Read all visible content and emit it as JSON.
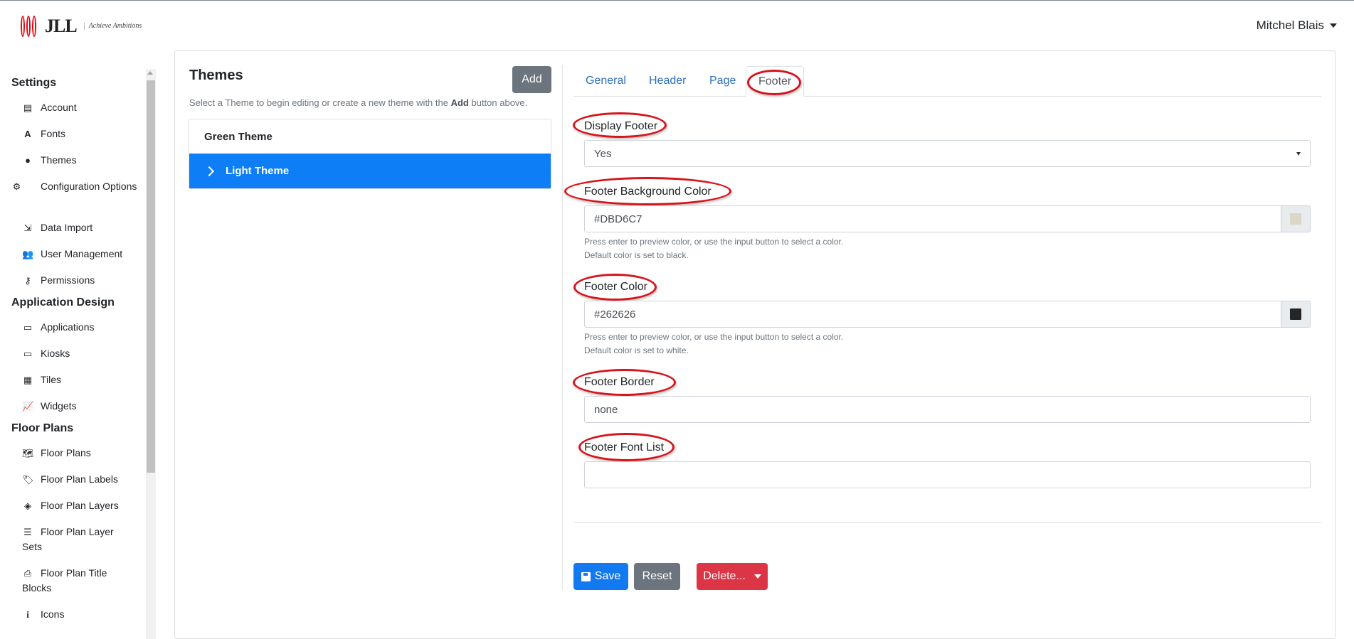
{
  "header": {
    "logo_text": "JLL",
    "logo_tagline": "Achieve Ambitions",
    "user_name": "Mitchel Blais"
  },
  "sidebar": {
    "sections": [
      {
        "title": "Settings",
        "items": [
          {
            "label": "Account",
            "icon": "table-icon"
          },
          {
            "label": "Fonts",
            "icon": "font-icon"
          },
          {
            "label": "Themes",
            "icon": "palette-icon"
          },
          {
            "label": "Configuration Options",
            "icon": "gear-icon"
          },
          {
            "label": "Data Import",
            "icon": "file-import-icon"
          },
          {
            "label": "User Management",
            "icon": "users-icon"
          },
          {
            "label": "Permissions",
            "icon": "key-icon"
          }
        ]
      },
      {
        "title": "Application Design",
        "items": [
          {
            "label": "Applications",
            "icon": "tablet-icon"
          },
          {
            "label": "Kiosks",
            "icon": "tablet-icon"
          },
          {
            "label": "Tiles",
            "icon": "grid-icon"
          },
          {
            "label": "Widgets",
            "icon": "chart-icon"
          }
        ]
      },
      {
        "title": "Floor Plans",
        "items": [
          {
            "label": "Floor Plans",
            "icon": "map-icon"
          },
          {
            "label": "Floor Plan Labels",
            "icon": "tags-icon"
          },
          {
            "label": "Floor Plan Layers",
            "icon": "layers-icon"
          },
          {
            "label": "Floor Plan Layer Sets",
            "icon": "tasks-icon"
          },
          {
            "label": "Floor Plan Title Blocks",
            "icon": "print-icon"
          },
          {
            "label": "Icons",
            "icon": "info-icon"
          }
        ]
      }
    ]
  },
  "themes": {
    "title": "Themes",
    "add_label": "Add",
    "hint_before": "Select a Theme to begin editing or create a new theme with the ",
    "hint_bold": "Add",
    "hint_after": " button above.",
    "items": [
      {
        "label": "Green Theme",
        "active": false
      },
      {
        "label": "Light Theme",
        "active": true
      }
    ]
  },
  "tabs": [
    {
      "label": "General",
      "active": false
    },
    {
      "label": "Header",
      "active": false
    },
    {
      "label": "Page",
      "active": false
    },
    {
      "label": "Footer",
      "active": true
    }
  ],
  "form": {
    "display_footer": {
      "label": "Display Footer",
      "value": "Yes"
    },
    "footer_bg_color": {
      "label": "Footer Background Color",
      "value": "#DBD6C7",
      "swatch": "#DBD6C7",
      "help1": "Press enter to preview color, or use the input button to select a color.",
      "help2": "Default color is set to black."
    },
    "footer_color": {
      "label": "Footer Color",
      "value": "#262626",
      "swatch": "#262626",
      "help1": "Press enter to preview color, or use the input button to select a color.",
      "help2": "Default color is set to white."
    },
    "footer_border": {
      "label": "Footer Border",
      "value": "none"
    },
    "footer_font_list": {
      "label": "Footer Font List",
      "value": ""
    }
  },
  "actions": {
    "save_label": "Save",
    "reset_label": "Reset",
    "delete_label": "Delete..."
  },
  "colors": {
    "primary": "#1379f0",
    "active_theme": "#0d7ef5",
    "danger": "#dc3545",
    "secondary": "#6c757d",
    "annotation": "#d8131b"
  }
}
